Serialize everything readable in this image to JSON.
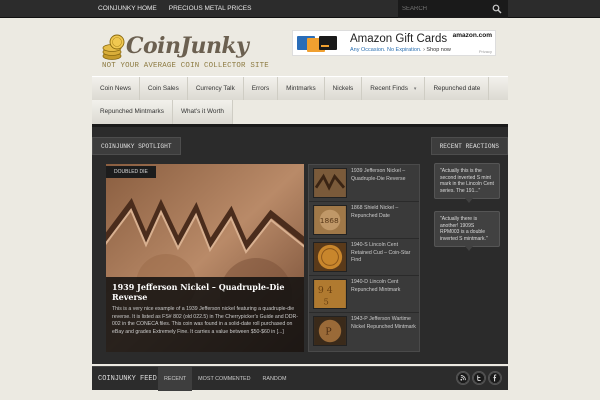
{
  "topbar": {
    "nav": [
      "CoinJunky Home",
      "Precious Metal Prices"
    ],
    "search_placeholder": "Search"
  },
  "header": {
    "logo_text": "CoinJunky",
    "tagline": "Not your average coin collector site"
  },
  "ad": {
    "title": "Amazon Gift Cards",
    "subtitle_a": "Any Occasion. No Expiration. ",
    "subtitle_b": "› Shop now",
    "brand": "amazon.com",
    "privacy": "Privacy"
  },
  "mainnav": {
    "row1": [
      "Coin News",
      "Coin Sales",
      "Currency Talk",
      "Errors",
      "Mintmarks",
      "Nickels",
      "Recent Finds",
      "Repunched date"
    ],
    "row2": [
      "Repunched Mintmarks",
      "What's it Worth"
    ],
    "dropdown_caret": "▾"
  },
  "spotlight": {
    "label": "CoinJunky Spotlight",
    "featured": {
      "badge": "Doubled Die",
      "title": "1939 Jefferson Nickel – Quadruple-Die Reverse",
      "excerpt": "This is a very nice example of a 1939 Jefferson nickel featuring a quadruple-die reverse. It is listed as FS# 802 (old 022.5) in The Cherrypicker's Guide and DDR-002 in the CONECA files. This coin was found in a solid-date roll purchased on eBay and grades Extremely Fine. It carries a value between $50-$60 in [...]"
    },
    "thumbs": [
      {
        "title": "1939 Jefferson Nickel – Quadruple-Die Reverse",
        "color": "#7a5a3a"
      },
      {
        "title": "1868 Shield Nickel – Repunched Date",
        "color": "#a07848"
      },
      {
        "title": "1940-S Lincoln Cent Retained Cud – Coin-Star Find",
        "color": "#b8762c"
      },
      {
        "title": "1940-D Lincoln Cent Repunched Mintmark",
        "color": "#b07a30"
      },
      {
        "title": "1943-P Jefferson Wartime Nickel Repunched Mintmark",
        "color": "#9a6a38"
      }
    ]
  },
  "reactions": {
    "label": "Recent Reactions",
    "items": [
      "\"Actually this is the second inverted S mint mark in the Lincoln Cent series. The 191...\"",
      "\"Actually there is another! 1909S RPM003 is a double inverted S mintmark.\""
    ]
  },
  "feed": {
    "label": "CoinJunky Feed",
    "tabs": [
      "Recent",
      "Most Commented",
      "Random"
    ],
    "social": [
      "rss-icon",
      "twitter-icon",
      "facebook-icon"
    ]
  }
}
